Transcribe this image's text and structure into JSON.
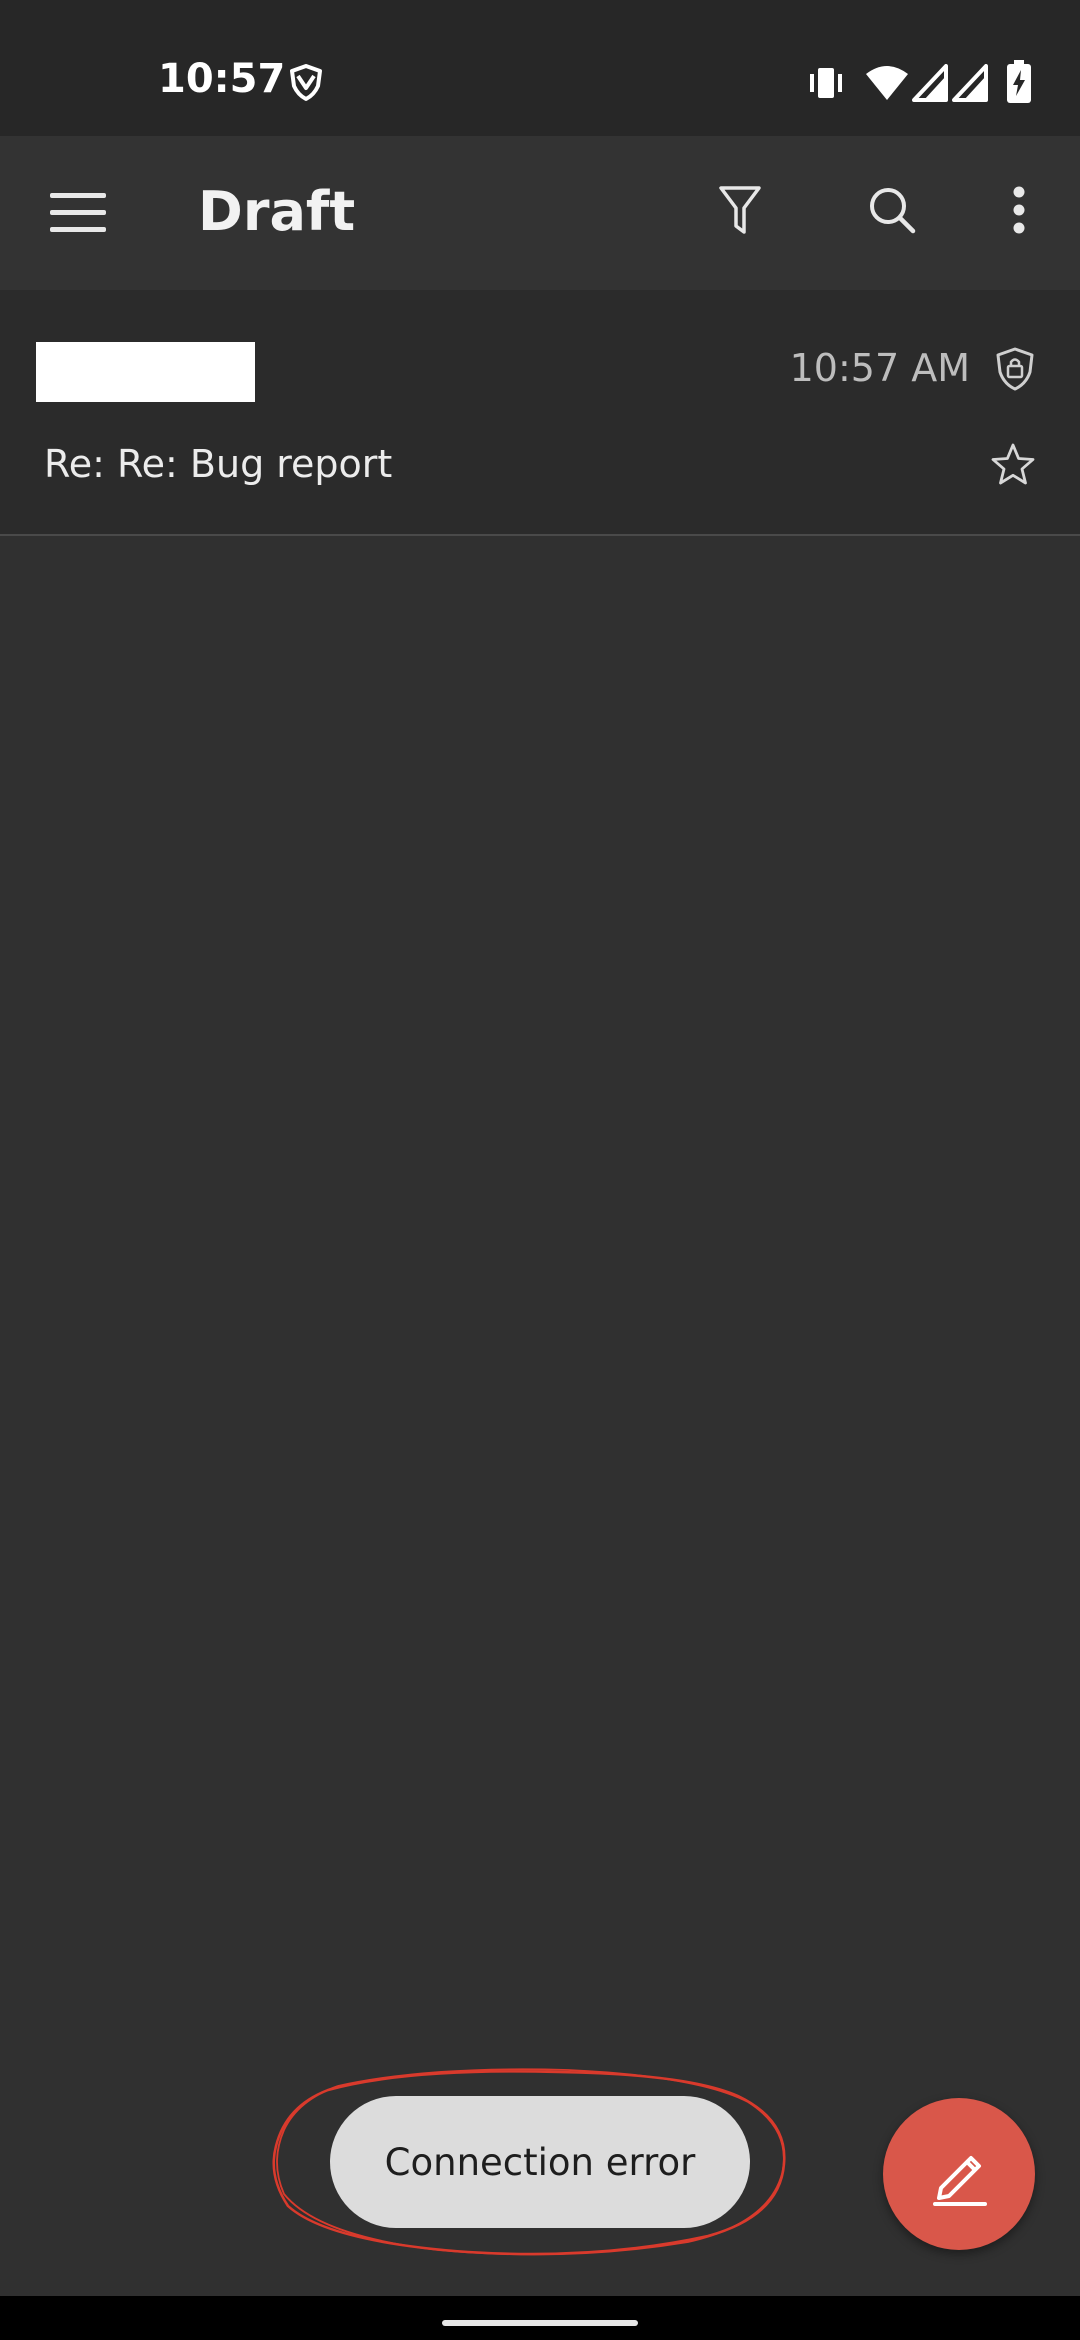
{
  "status_bar": {
    "time": "10:57",
    "icons": [
      "shield-app-icon",
      "vibrate-icon",
      "wifi-icon",
      "signal-icon",
      "signal-icon",
      "battery-charging-icon"
    ]
  },
  "app_bar": {
    "title": "Draft",
    "icons": [
      "menu-icon",
      "filter-icon",
      "search-icon",
      "more-vert-icon"
    ]
  },
  "messages": [
    {
      "time": "10:57 AM",
      "subject": "Re: Re: Bug report",
      "icons": [
        "encrypted-shield-icon",
        "star-icon"
      ]
    }
  ],
  "toast": {
    "text": "Connection error"
  },
  "fab": {
    "icon": "compose-pencil-icon",
    "color": "#d9574a"
  },
  "colors": {
    "background": "#303030",
    "app_bar": "#333333",
    "status_bar": "#272727",
    "accent": "#d9574a"
  }
}
